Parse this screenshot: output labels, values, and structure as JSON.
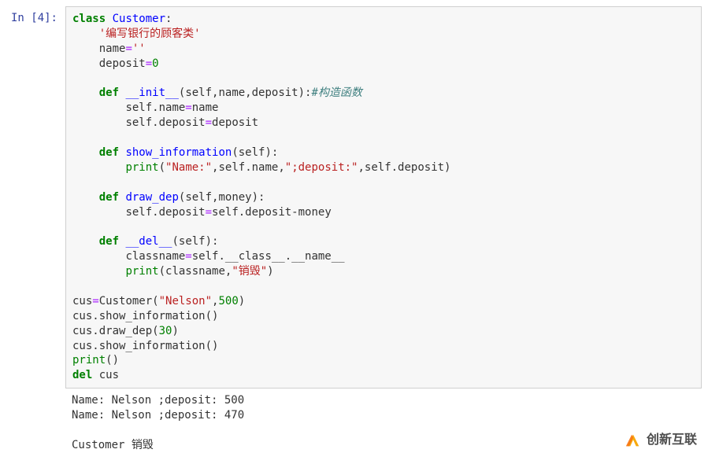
{
  "prompt": "In  [4]:",
  "code": {
    "l1": {
      "kw": "class",
      "sp": " ",
      "cls": "Customer",
      "colon": ":"
    },
    "l2": {
      "indent": "    ",
      "str": "'编写银行的顾客类'"
    },
    "l3": {
      "indent": "    ",
      "a": "name",
      "eq": "=",
      "str": "''"
    },
    "l4": {
      "indent": "    ",
      "a": "deposit",
      "eq": "=",
      "num": "0"
    },
    "blank1": "",
    "l5": {
      "indent": "    ",
      "kw": "def",
      "sp": " ",
      "fn": "__init__",
      "sig": "(self,name,deposit):",
      "cmt": "#构造函数"
    },
    "l6": {
      "indent": "        ",
      "a": "self.name",
      "eq": "=",
      "b": "name"
    },
    "l7": {
      "indent": "        ",
      "a": "self.deposit",
      "eq": "=",
      "b": "deposit"
    },
    "blank2": "",
    "l8": {
      "indent": "    ",
      "kw": "def",
      "sp": " ",
      "fn": "show_information",
      "sig": "(self):"
    },
    "l9": {
      "indent": "        ",
      "bi": "print",
      "open": "(",
      "s1": "\"Name:\"",
      "c1": ",self.name,",
      "s2": "\";deposit:\"",
      "c2": ",self.deposit)"
    },
    "blank3": "",
    "l10": {
      "indent": "    ",
      "kw": "def",
      "sp": " ",
      "fn": "draw_dep",
      "sig": "(self,money):"
    },
    "l11": {
      "indent": "        ",
      "a": "self.deposit",
      "eq": "=",
      "b": "self.deposit-money"
    },
    "blank4": "",
    "l12": {
      "indent": "    ",
      "kw": "def",
      "sp": " ",
      "fn": "__del__",
      "sig": "(self):"
    },
    "l13": {
      "indent": "        ",
      "a": "classname",
      "eq": "=",
      "b": "self.__class__.__name__"
    },
    "l14": {
      "indent": "        ",
      "bi": "print",
      "open": "(classname,",
      "s1": "\"销毁\"",
      "close": ")"
    },
    "blank5": "",
    "l15": {
      "a": "cus",
      "eq": "=",
      "b": "Customer(",
      "s1": "\"Nelson\"",
      "c1": ",",
      "num": "500",
      "close": ")"
    },
    "l16": {
      "a": "cus.show_information()"
    },
    "l17": {
      "a": "cus.draw_dep(",
      "num": "30",
      "close": ")"
    },
    "l18": {
      "a": "cus.show_information()"
    },
    "l19": {
      "bi": "print",
      "a": "()"
    },
    "l20": {
      "kw": "del",
      "sp": " ",
      "a": "cus"
    }
  },
  "output": {
    "l1": "Name: Nelson ;deposit: 500",
    "l2": "Name: Nelson ;deposit: 470",
    "blank": "",
    "l3": "Customer 销毁"
  },
  "watermark": "创新互联"
}
